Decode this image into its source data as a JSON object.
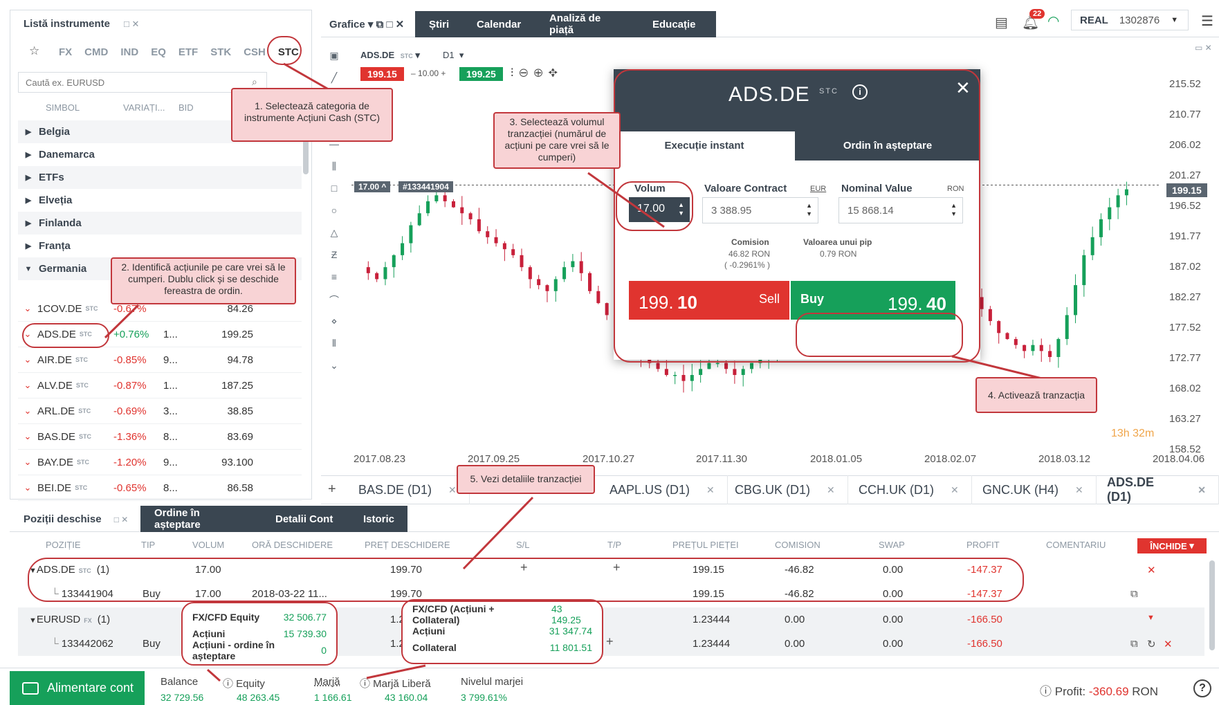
{
  "left_panel": {
    "title": "Listă instrumente",
    "categories": [
      "FX",
      "CMD",
      "IND",
      "EQ",
      "ETF",
      "STK",
      "CSH",
      "STC"
    ],
    "search_placeholder": "Caută ex. EURUSD",
    "headers": [
      "SIMBOL",
      "VARIAȚI...",
      "BID"
    ],
    "groups": [
      "Belgia",
      "Danemarca",
      "ETFs",
      "Elveția",
      "Finlanda",
      "Franța",
      "Germania"
    ],
    "instruments": [
      {
        "symbol": "1COV.DE",
        "tag": "STC",
        "change": "-0.67%",
        "mid": "",
        "bid": "84.26",
        "dir": "neg"
      },
      {
        "symbol": "ADS.DE",
        "tag": "STC",
        "change": "+0.76%",
        "mid": "1...",
        "bid": "199.25",
        "dir": "pos"
      },
      {
        "symbol": "AIR.DE",
        "tag": "STC",
        "change": "-0.85%",
        "mid": "9...",
        "bid": "94.78",
        "dir": "neg"
      },
      {
        "symbol": "ALV.DE",
        "tag": "STC",
        "change": "-0.87%",
        "mid": "1...",
        "bid": "187.25",
        "dir": "neg"
      },
      {
        "symbol": "ARL.DE",
        "tag": "STC",
        "change": "-0.69%",
        "mid": "3...",
        "bid": "38.85",
        "dir": "neg"
      },
      {
        "symbol": "BAS.DE",
        "tag": "STC",
        "change": "-1.36%",
        "mid": "8...",
        "bid": "83.69",
        "dir": "neg"
      },
      {
        "symbol": "BAY.DE",
        "tag": "STC",
        "change": "-1.20%",
        "mid": "9...",
        "bid": "93.100",
        "dir": "neg"
      },
      {
        "symbol": "BEI.DE",
        "tag": "STC",
        "change": "-0.65%",
        "mid": "8...",
        "bid": "86.58",
        "dir": "neg"
      }
    ]
  },
  "top_tabs": {
    "grafice": "Grafice",
    "stiri": "Știri",
    "calendar": "Calendar",
    "analiza": "Analiză de piață",
    "educatie": "Educație"
  },
  "account": {
    "type": "REAL",
    "number": "1302876",
    "notifications": "22"
  },
  "chart": {
    "symbol": "ADS.DE",
    "tag": "STC",
    "timeframe": "D1",
    "sell": "199.15",
    "step": "10.00",
    "buy": "199.25",
    "order_line_label": "17.00 ^",
    "order_id": "#133441904",
    "current_price": "199.15",
    "countdown": "13h 32m",
    "yticks": [
      "215.52",
      "210.77",
      "206.02",
      "201.27",
      "196.52",
      "191.77",
      "187.02",
      "182.27",
      "177.52",
      "172.77",
      "168.02",
      "163.27",
      "158.52"
    ],
    "xticks": [
      "2017.08.23",
      "2017.09.25",
      "2017.10.27",
      "2017.11.30",
      "2018.01.05",
      "2018.02.07",
      "2018.03.12",
      "2018.04.06"
    ]
  },
  "chart_tabs": [
    "BAS.DE (D1)",
    "AAPL.US (D1)",
    "CBG.UK (D1)",
    "CCH.UK (D1)",
    "GNC.UK (H4)",
    "ADS.DE (D1)"
  ],
  "modal": {
    "symbol": "ADS.DE",
    "tag": "STC",
    "tab_instant": "Execuție instant",
    "tab_pending": "Ordin în așteptare",
    "volume_label": "Volum",
    "volume": "17.00",
    "contract_label": "Valoare Contract",
    "contract_ccy": "EUR",
    "contract_value": "3 388.95",
    "nominal_label": "Nominal Value",
    "nominal_ccy": "RON",
    "nominal_value": "15 868.14",
    "commission_label": "Comision",
    "commission_value": "46.82 RON",
    "commission_pct": "( -0.2961% )",
    "pip_label": "Valoarea unui pip",
    "pip_value": "0.79 RON",
    "sell_int": "199.",
    "sell_dec": "10",
    "sell_label": "Sell",
    "buy_label": "Buy",
    "buy_int": "199.",
    "buy_dec": "40"
  },
  "callouts": {
    "c1": "1. Selectează categoria de instrumente Acțiuni Cash (STC)",
    "c2": "2. Identifică acțiunile pe care vrei să le cumperi. Dublu click și se deschide fereastra de ordin.",
    "c3": "3. Selectează volumul tranzacției (numărul de acțiuni pe care vrei să le cumperi)",
    "c4": "4. Activează tranzacția",
    "c5": "5. Vezi detaliile tranzacției"
  },
  "positions": {
    "tabs": [
      "Poziții deschise",
      "Ordine în așteptare",
      "Detalii Cont",
      "Istoric"
    ],
    "headers": [
      "POZIȚIE",
      "TIP",
      "VOLUM",
      "ORĂ DESCHIDERE",
      "PREȚ DESCHIDERE",
      "S/L",
      "T/P",
      "PREȚUL PIEȚEI",
      "COMISION",
      "SWAP",
      "PROFIT",
      "COMENTARIU"
    ],
    "close_btn": "ÎNCHIDE",
    "rows": [
      {
        "pos": "ADS.DE",
        "tag": "STC",
        "count": "(1)",
        "type": "",
        "vol": "17.00",
        "time": "",
        "open": "199.70",
        "market": "199.15",
        "comm": "-46.82",
        "swap": "0.00",
        "profit": "-147.37"
      },
      {
        "pos": "133441904",
        "tag": "",
        "count": "",
        "type": "Buy",
        "vol": "17.00",
        "time": "2018-03-22 11...",
        "open": "199.70",
        "market": "199.15",
        "comm": "-46.82",
        "swap": "0.00",
        "profit": "-147.37"
      },
      {
        "pos": "EURUSD",
        "tag": "FX",
        "count": "(1)",
        "type": "",
        "vol": "",
        "time": "",
        "open": "1.2",
        "market": "1.23444",
        "comm": "0.00",
        "swap": "0.00",
        "profit": "-166.50"
      },
      {
        "pos": "133442062",
        "tag": "",
        "count": "",
        "type": "Buy",
        "vol": "",
        "time": "",
        "open": "1.2",
        "market": "1.23444",
        "comm": "0.00",
        "swap": "0.00",
        "profit": "-166.50"
      }
    ]
  },
  "equity_box": {
    "r1l": "FX/CFD Equity",
    "r1v": "32 506.77",
    "r2l": "Acțiuni",
    "r2v": "15 739.30",
    "r3l": "Acțiuni - ordine în așteptare",
    "r3v": "0"
  },
  "margin_box": {
    "r1l": "FX/CFD (Acțiuni + Collateral)",
    "r1v": "43 149.25",
    "r2l": "Acțiuni",
    "r2v": "31 347.74",
    "r3l": "Collateral",
    "r3v": "11 801.51"
  },
  "status": {
    "deposit": "Alimentare cont",
    "balance_l": "Balance",
    "balance_v": "32 729.56",
    "equity_l": "Equity",
    "equity_v": "48 263.45",
    "margin_l": "Marjă",
    "margin_v": "1 166.61",
    "free_l": "Marjă Liberă",
    "free_v": "43 160.04",
    "level_l": "Nivelul marjei",
    "level_v": "3 799.61%",
    "profit_l": "Profit:",
    "profit_v": "-360.69",
    "profit_ccy": "RON"
  }
}
